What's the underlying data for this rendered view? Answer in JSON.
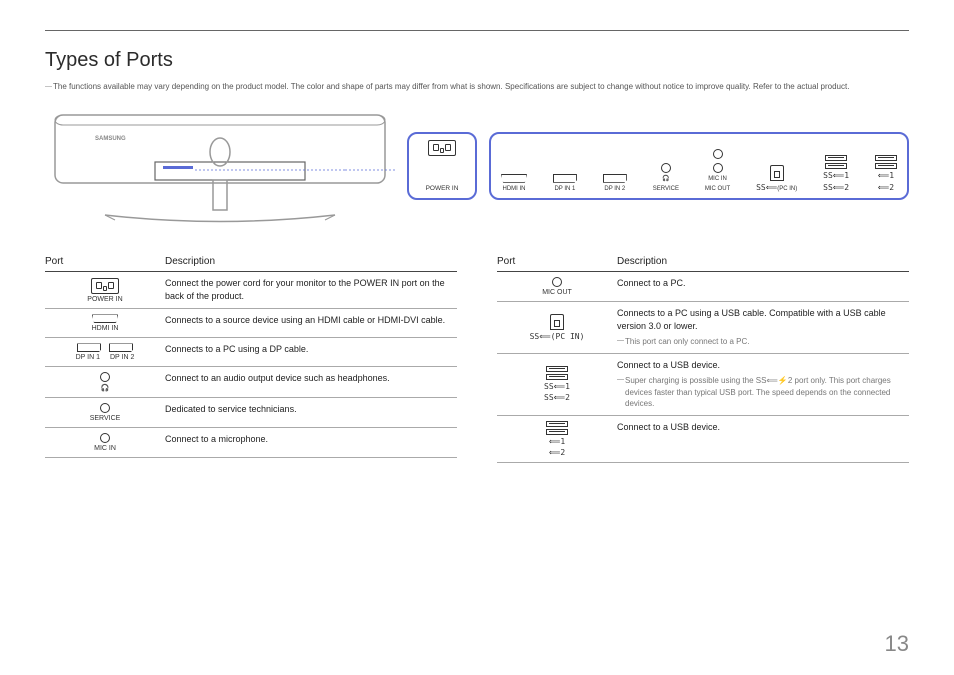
{
  "page_number": "13",
  "heading": "Types of Ports",
  "disclaimer": "The functions available may vary depending on the product model. The color and shape of parts may differ from what is shown. Specifications are subject to change without notice to improve quality. Refer to the actual product.",
  "diagram": {
    "power_label": "POWER IN",
    "ports": {
      "hdmi": "HDMI IN",
      "dp1": "DP IN 1",
      "dp2": "DP IN 2",
      "hp": "🎧",
      "service": "SERVICE",
      "micin": "MIC IN",
      "micout": "MIC OUT",
      "pcin_sym": "SS⟸",
      "pcin": "(PC IN)",
      "ss1": "SS⟸1",
      "ss2": "SS⟸2",
      "u1": "⟸1",
      "u2": "⟸2"
    }
  },
  "table_headers": {
    "port": "Port",
    "desc": "Description"
  },
  "left": [
    {
      "label": "POWER IN",
      "desc": "Connect the power cord for your monitor to the POWER IN port on the back of the product.",
      "icon": "power"
    },
    {
      "label": "HDMI IN",
      "desc": "Connects to a source device using an HDMI cable or HDMI-DVI cable.",
      "icon": "hdmi"
    },
    {
      "label_a": "DP IN 1",
      "label_b": "DP IN 2",
      "desc": "Connects to a PC using a DP cable.",
      "icon": "dp-pair"
    },
    {
      "label": "🎧",
      "desc": "Connect to an audio output device such as headphones.",
      "icon": "circle"
    },
    {
      "label": "SERVICE",
      "desc": "Dedicated to service technicians.",
      "icon": "circle"
    },
    {
      "label": "MIC IN",
      "desc": "Connect to a microphone.",
      "icon": "circle"
    }
  ],
  "right": [
    {
      "label": "MIC OUT",
      "desc": "Connect to a PC.",
      "icon": "circle"
    },
    {
      "label_sym": "SS⟸(PC IN)",
      "desc": "Connects to a PC using a USB cable. Compatible with a USB cable version 3.0 or lower.",
      "note": "This port can only connect to a PC.",
      "icon": "usbb"
    },
    {
      "label_a": "SS⟸1",
      "label_b": "SS⟸2",
      "desc": "Connect to a USB device.",
      "note": "Super charging is possible using the SS⟸⚡2 port only. This port charges devices faster than typical USB port. The speed depends on the connected devices.",
      "icon": "usba-stack"
    },
    {
      "label_a": "⟸1",
      "label_b": "⟸2",
      "desc": "Connect to a USB device.",
      "icon": "usba-stack"
    }
  ]
}
